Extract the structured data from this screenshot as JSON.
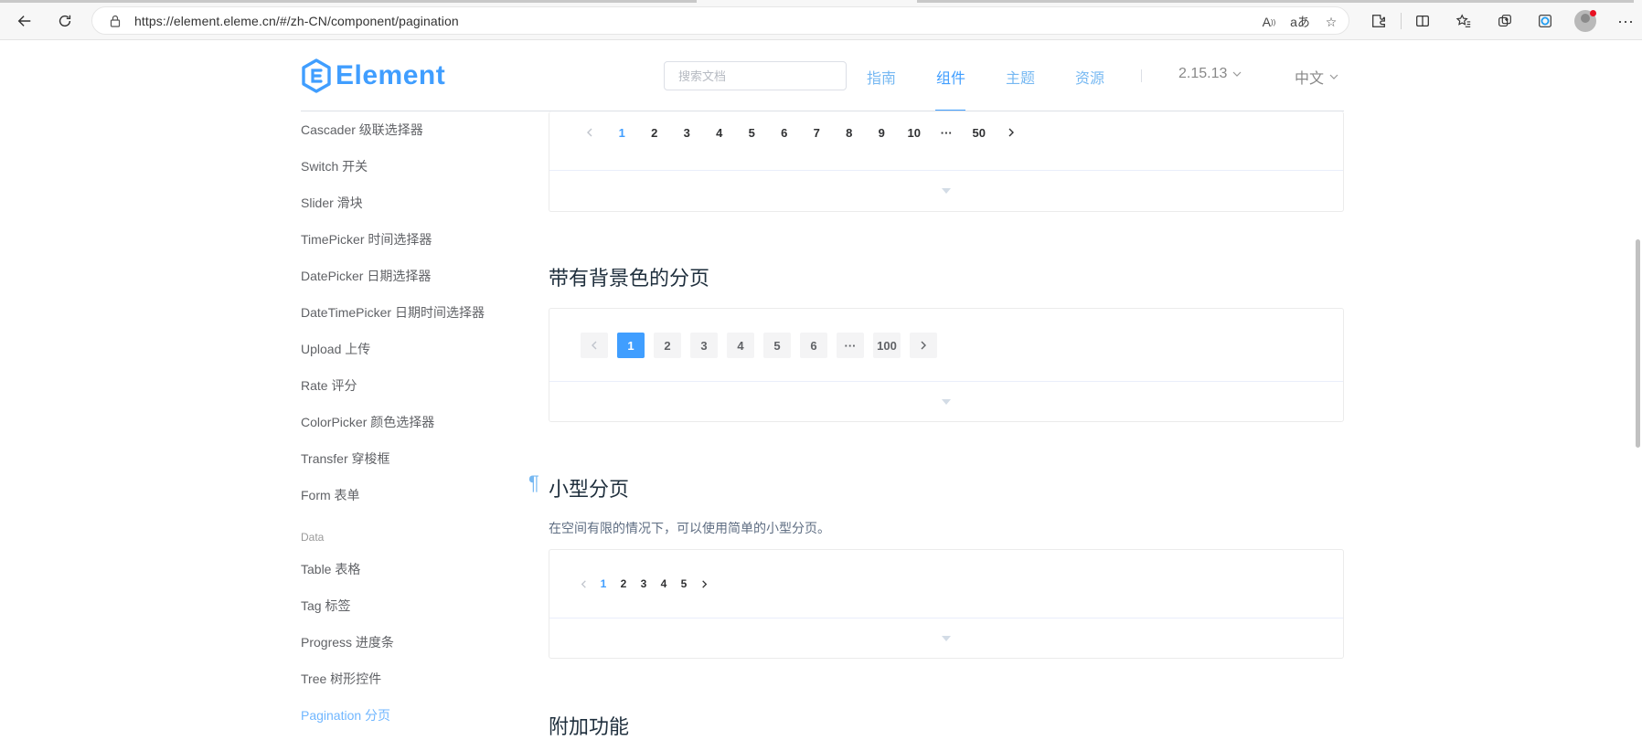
{
  "browser": {
    "url": "https://element.eleme.cn/#/zh-CN/component/pagination"
  },
  "header": {
    "logo_text": "Element",
    "search_placeholder": "搜索文档",
    "nav": [
      "指南",
      "组件",
      "主题",
      "资源"
    ],
    "active_nav": "组件",
    "version": "2.15.13",
    "language": "中文"
  },
  "sidebar": {
    "items_before": [
      "Cascader 级联选择器",
      "Switch 开关",
      "Slider 滑块",
      "TimePicker 时间选择器",
      "DatePicker 日期选择器",
      "DateTimePicker 日期时间选择器",
      "Upload 上传",
      "Rate 评分",
      "ColorPicker 颜色选择器",
      "Transfer 穿梭框",
      "Form 表单"
    ],
    "group": "Data",
    "items_after": [
      "Table 表格",
      "Tag 标签",
      "Progress 进度条",
      "Tree 树形控件",
      "Pagination 分页"
    ],
    "active_item": "Pagination 分页"
  },
  "content": {
    "pager1": {
      "pages": [
        "1",
        "2",
        "3",
        "4",
        "5",
        "6",
        "7",
        "8",
        "9",
        "10",
        "···",
        "50"
      ],
      "current": "1"
    },
    "section_bg": {
      "title": "带有背景色的分页",
      "pages": [
        "1",
        "2",
        "3",
        "4",
        "5",
        "6",
        "···",
        "100"
      ],
      "current": "1"
    },
    "section_small": {
      "anchor": "¶",
      "title": "小型分页",
      "desc": "在空间有限的情况下，可以使用简单的小型分页。",
      "pages": [
        "1",
        "2",
        "3",
        "4",
        "5"
      ],
      "current": "1"
    },
    "section_extra": {
      "title": "附加功能"
    }
  },
  "colors": {
    "primary": "#409eff",
    "text": "#303133",
    "sidebar_text": "#606266",
    "border": "#ebebeb"
  }
}
